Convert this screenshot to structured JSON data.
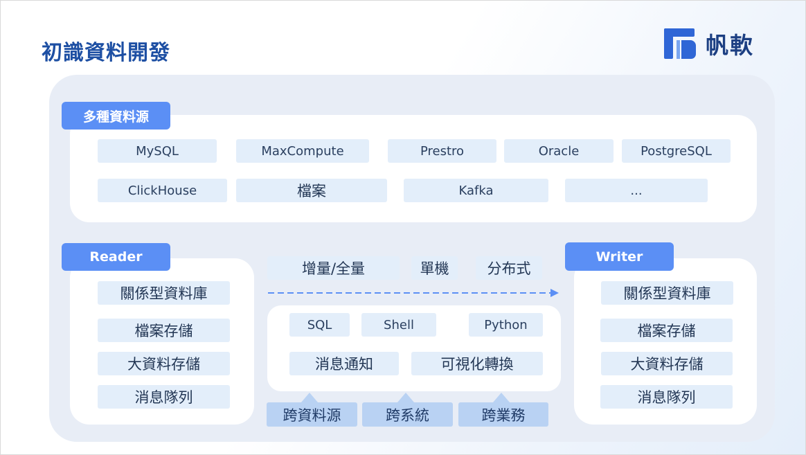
{
  "title": "初識資料開發",
  "logo": {
    "text": "帆軟",
    "mark_color": "#2f66d6"
  },
  "sources": {
    "tag": "多種資料源",
    "row1": [
      "MySQL",
      "MaxCompute",
      "Prestro",
      "Oracle",
      "PostgreSQL"
    ],
    "row2": [
      "ClickHouse",
      "檔案",
      "Kafka",
      "..."
    ]
  },
  "reader": {
    "tag": "Reader",
    "items": [
      "關係型資料庫",
      "檔案存儲",
      "大資料存儲",
      "消息隊列"
    ]
  },
  "writer": {
    "tag": "Writer",
    "items": [
      "關係型資料庫",
      "檔案存儲",
      "大資料存儲",
      "消息隊列"
    ]
  },
  "modes": [
    "增量/全量",
    "單機",
    "分布式"
  ],
  "center": {
    "row1": [
      "SQL",
      "Shell",
      "Python"
    ],
    "row2": [
      "消息通知",
      "可視化轉換"
    ]
  },
  "bottom": [
    "跨資料源",
    "跨系統",
    "跨業務"
  ],
  "colors": {
    "title": "#1d4fa3",
    "tag": "#5b8ff5",
    "chip": "#e3eefa",
    "chip_dark": "#b9d2f3",
    "arrow": "#5b8ff5"
  }
}
